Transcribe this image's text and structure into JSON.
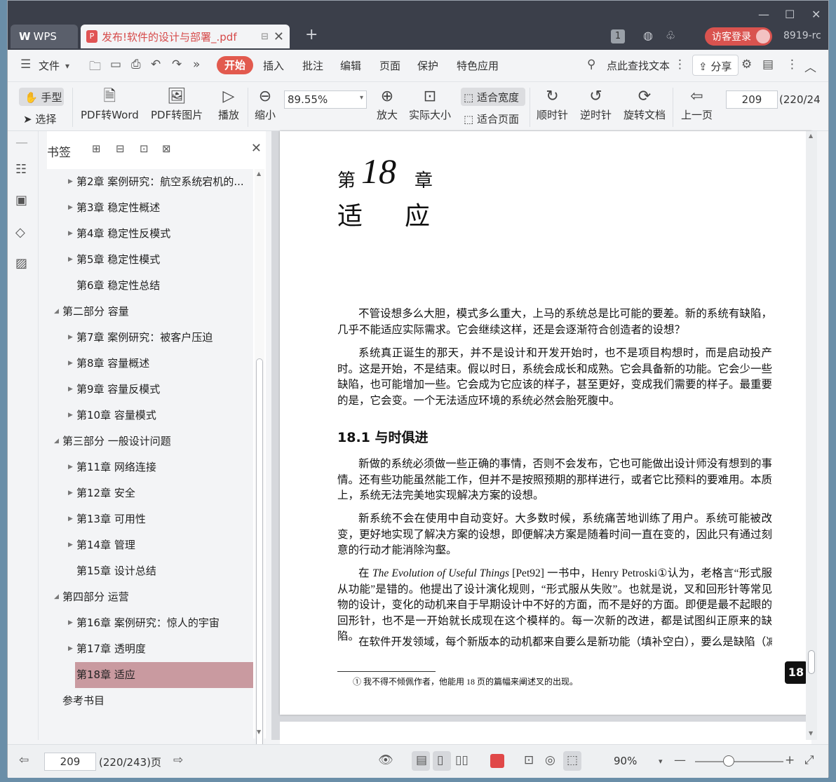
{
  "titlebar": {
    "app_tab": "WPS",
    "doc_tab": "发布!软件的设计与部署_.pdf",
    "badge": "1",
    "login": "访客登录",
    "version": "8919-rc"
  },
  "menubar": {
    "file": "文件",
    "items": [
      "开始",
      "插入",
      "批注",
      "编辑",
      "页面",
      "保护",
      "特色应用"
    ],
    "search": "点此查找文本",
    "share": "分享"
  },
  "toolbar": {
    "hand": "手型",
    "select": "选择",
    "pdf_to_word": "PDF转Word",
    "pdf_to_image": "PDF转图片",
    "play": "播放",
    "zoom_out": "缩小",
    "zoom_value": "89.55%",
    "zoom_in": "放大",
    "actual_size": "实际大小",
    "fit_width": "适合宽度",
    "fit_page": "适合页面",
    "clockwise": "顺时针",
    "counterclockwise": "逆时针",
    "rotate_doc": "旋转文档",
    "prev_page": "上一页",
    "page_value": "209",
    "page_total": "(220/24"
  },
  "bookmarks": {
    "title": "书签",
    "items": [
      "第2章  案例研究：航空系统宕机的...",
      "第3章  稳定性概述",
      "第4章  稳定性反模式",
      "第5章  稳定性模式",
      "第6章  稳定性总结",
      "第二部分  容量",
      "第7章  案例研究：被客户压迫",
      "第8章  容量概述",
      "第9章  容量反模式",
      "第10章  容量模式",
      "第三部分  一般设计问题",
      "第11章  网络连接",
      "第12章  安全",
      "第13章  可用性",
      "第14章  管理",
      "第15章  设计总结",
      "第四部分  运营",
      "第16章  案例研究：惊人的宇宙",
      "第17章  透明度",
      "第18章  适应",
      "参考书目"
    ]
  },
  "page": {
    "chapter_prefix": "第",
    "chapter_num": "18",
    "chapter_suffix": "章",
    "chapter_title": "适应",
    "p1": "不管设想多么大胆，模式多么重大，上马的系统总是比可能的要差。新的系统有缺陷，几乎不能适应实际需求。它会继续这样，还是会逐渐符合创造者的设想？",
    "p2": "系统真正诞生的那天，并不是设计和开发开始时，也不是项目构想时，而是启动投产时。这是开始，不是结束。假以时日，系统会成长和成熟。它会具备新的功能。它会少一些缺陷，也可能增加一些。它会成为它应该的样子，甚至更好，变成我们需要的样子。最重要的是，它会变。一个无法适应环境的系统必然会胎死腹中。",
    "section": "18.1    与时俱进",
    "p3": "新做的系统必须做一些正确的事情，否则不会发布，它也可能做出设计师没有想到的事情。还有些功能虽然能工作，但并不是按照预期的那样进行，或者它比预料的要难用。本质上，系统无法完美地实现解决方案的设想。",
    "p4": "新系统不会在使用中自动变好。大多数时候，系统痛苦地训练了用户。系统可能被改变，更好地实现了解决方案的设想，即便解决方案是随着时间一直在变的，因此只有通过刻意的行动才能消除沟壑。",
    "p5_a": "在 ",
    "p5_book": "The Evolution of Useful Things",
    "p5_b": " [Pet92] 一书中，Henry Petroski①认为，老格言“形式服从功能”是错的。他提出了设计演化规则，“形式服从失败”。也就是说，叉和回形针等常见物的设计，变化的动机来自于早期设计中不好的方面，而不是好的方面。即便是最不起眼的回形针，也不是一开始就长成现在这个模样的。每一次新的改进，都是试图纠正原来的缺陷。",
    "p6": "在软件开发领域，每个新版本的动机都来自要么是新功能（填补空白），要么是缺陷（减少",
    "footnote": "① 我不得不倾佩作者，他能用 18 页的篇幅来阐述叉的出现。",
    "page_badge": "18"
  },
  "status": {
    "page_value": "209",
    "page_total": "(220/243)页",
    "zoom": "90%"
  }
}
